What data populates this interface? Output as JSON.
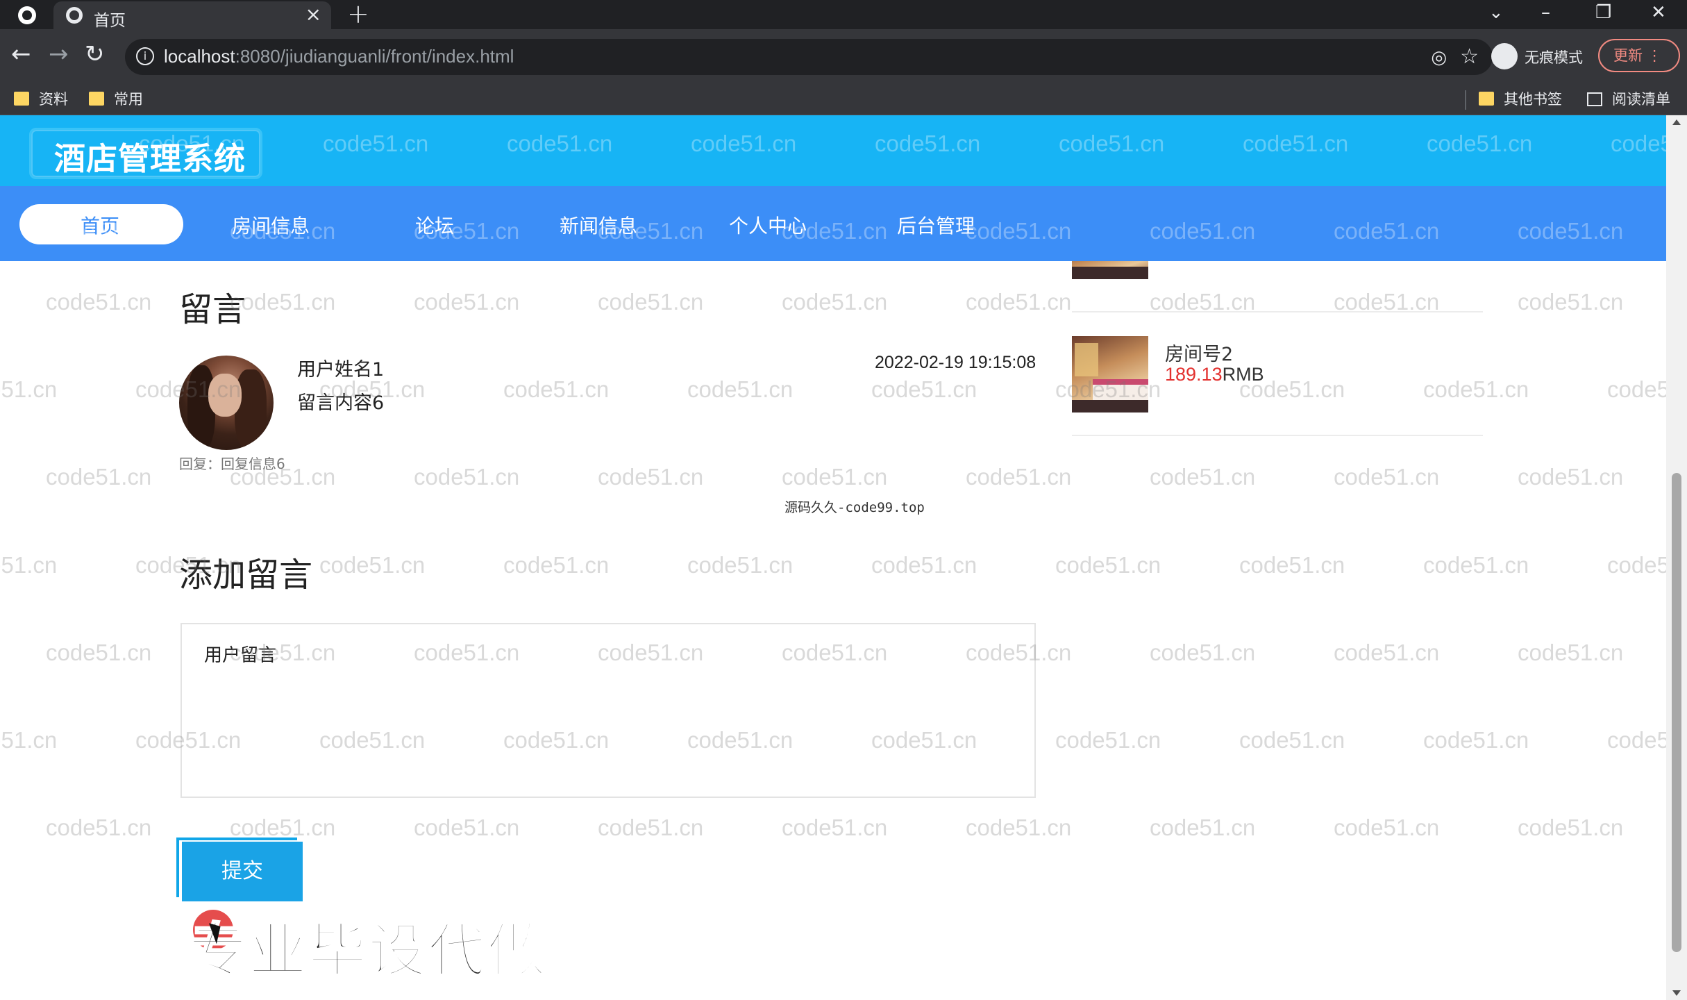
{
  "browser": {
    "tab_title": "首页",
    "tab_close": "×",
    "new_tab": "+",
    "url_host": "localhost",
    "url_rest": ":8080/jiudianguanli/front/index.html",
    "incognito_label": "无痕模式",
    "update_label": "更新",
    "nav_icons": [
      "back-arrow-icon",
      "forward-arrow-icon",
      "reload-icon"
    ],
    "window_controls": [
      "chevron-down-icon",
      "minimize-icon",
      "restore-icon",
      "close-icon"
    ],
    "bookmarks": [
      {
        "label": "资料"
      },
      {
        "label": "常用"
      }
    ],
    "other_bookmarks": "其他书签",
    "reading_list": "阅读清单"
  },
  "site": {
    "logo": "酒店管理系统",
    "nav": [
      {
        "label": "首页",
        "active": true
      },
      {
        "label": "房间信息"
      },
      {
        "label": "论坛"
      },
      {
        "label": "新闻信息"
      },
      {
        "label": "个人中心"
      },
      {
        "label": "后台管理"
      }
    ]
  },
  "message_section": {
    "title": "留言",
    "messages": [
      {
        "user": "用户姓名1",
        "content": "留言内容6",
        "time": "2022-02-19 19:15:08",
        "reply": "回复：回复信息6"
      }
    ]
  },
  "credit_text": "源码久久-code99.top",
  "add_message": {
    "title": "添加留言",
    "placeholder": "用户留言",
    "submit_label": "提交"
  },
  "rooms": [
    {
      "name": "房间号2",
      "price": "189.13",
      "currency": "RMB"
    }
  ],
  "promo_text": "专业毕设代做",
  "watermark": "code51.cn",
  "colors": {
    "header_top": "#17b4f5",
    "header_nav": "#3c8ef7",
    "price": "#e3312f",
    "submit": "#1aa3e6"
  }
}
